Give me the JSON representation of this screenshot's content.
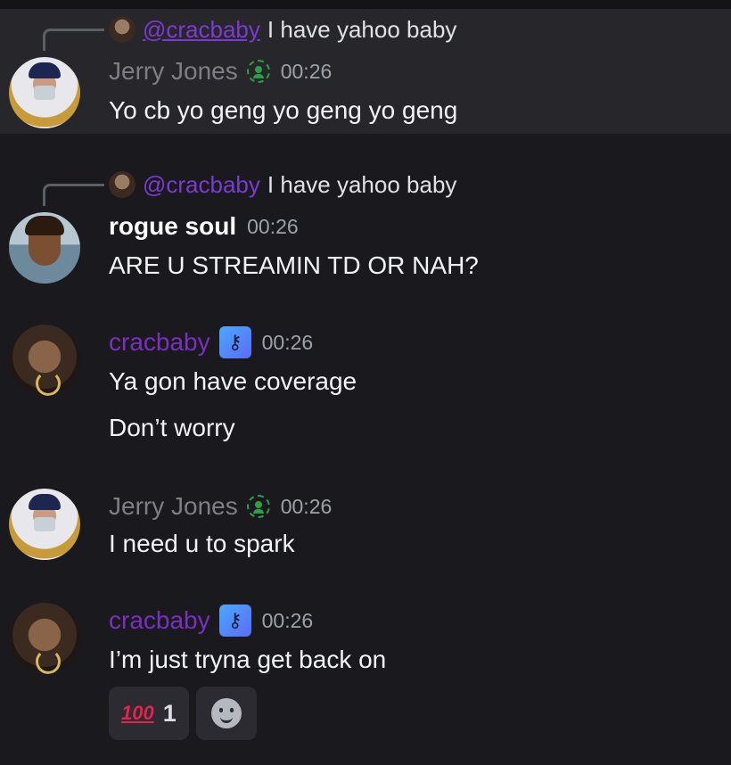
{
  "messages": [
    {
      "reply": {
        "mention": "@cracbaby",
        "text": "I have yahoo baby"
      },
      "author": "Jerry Jones",
      "time": "00:26",
      "lines": [
        "Yo cb yo geng yo geng yo geng"
      ],
      "badge": "green-person-icon"
    },
    {
      "reply": {
        "mention": "@cracbaby",
        "text": "I have yahoo baby"
      },
      "author": "rogue soul",
      "time": "00:26",
      "lines": [
        "ARE U STREAMIN TD OR NAH?"
      ]
    },
    {
      "author": "cracbaby",
      "time": "00:26",
      "lines": [
        "Ya gon have coverage",
        "Don’t worry"
      ],
      "badge": "key-icon"
    },
    {
      "author": "Jerry Jones",
      "time": "00:26",
      "lines": [
        "I need u to spark"
      ],
      "badge": "green-person-icon"
    },
    {
      "author": "cracbaby",
      "time": "00:26",
      "lines": [
        "I’m just tryna get back on"
      ],
      "badge": "key-icon",
      "reactions": [
        {
          "emoji": "100",
          "count": "1"
        }
      ]
    }
  ],
  "colors": {
    "background": "#1a1a1e",
    "highlight": "#27272b",
    "mention": "#7c3bd0",
    "cracbaby": "#7a2fc0",
    "badge_green": "#2f9e49"
  }
}
